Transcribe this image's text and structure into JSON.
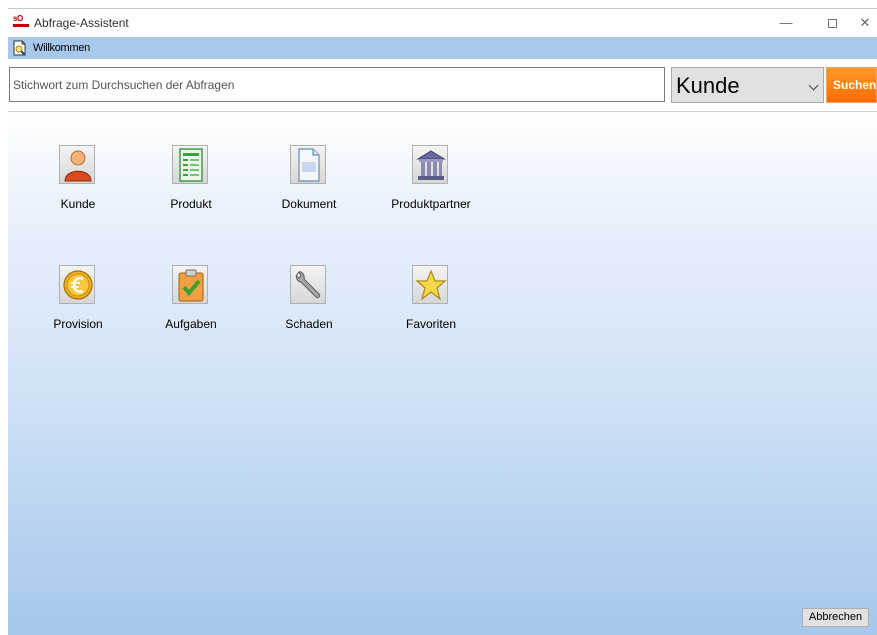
{
  "window": {
    "title": "Abfrage-Assistent",
    "minimize_glyph": "—",
    "close_glyph": "✕"
  },
  "tab": {
    "label": "Willkommen",
    "icon": "document-search-icon"
  },
  "search": {
    "placeholder": "Stichwort zum Durchsuchen der Abfragen",
    "value": "",
    "category_selected": "Kunde",
    "button_label": "Suchen"
  },
  "tiles": [
    {
      "label": "Kunde",
      "icon": "person-icon"
    },
    {
      "label": "Produkt",
      "icon": "product-list-icon"
    },
    {
      "label": "Dokument",
      "icon": "document-icon"
    },
    {
      "label": "Produktpartner",
      "icon": "bank-building-icon"
    },
    {
      "label": "Provision",
      "icon": "euro-coin-icon"
    },
    {
      "label": "Aufgaben",
      "icon": "clipboard-check-icon"
    },
    {
      "label": "Schaden",
      "icon": "wrench-icon"
    },
    {
      "label": "Favoriten",
      "icon": "star-icon"
    }
  ],
  "footer": {
    "cancel_label": "Abbrechen"
  },
  "colors": {
    "tabstrip": "#a9c8ee",
    "search_button": "#ff7a10",
    "gradient_bottom": "#a5c7ec"
  }
}
